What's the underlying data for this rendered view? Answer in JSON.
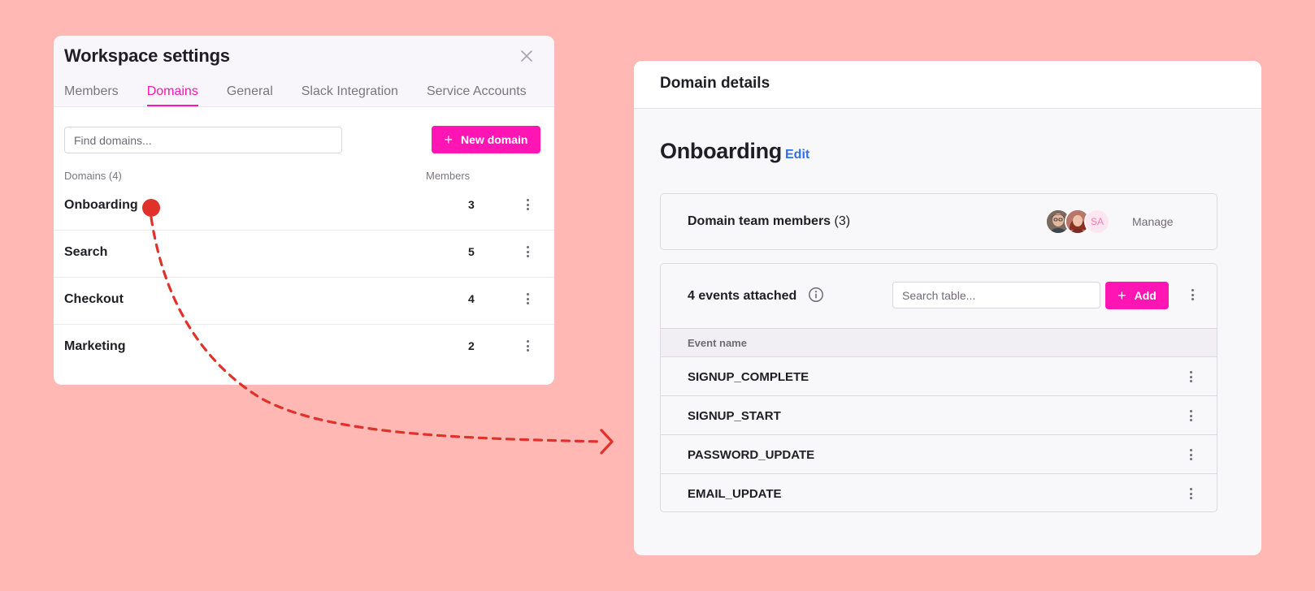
{
  "workspace_settings": {
    "title": "Workspace settings",
    "tabs": [
      {
        "label": "Members",
        "active": false
      },
      {
        "label": "Domains",
        "active": true
      },
      {
        "label": "General",
        "active": false
      },
      {
        "label": "Slack Integration",
        "active": false
      },
      {
        "label": "Service Accounts",
        "active": false
      }
    ],
    "search": {
      "placeholder": "Find domains...",
      "value": ""
    },
    "new_domain_label": "New domain",
    "columns": {
      "domains": "Domains (4)",
      "members": "Members"
    },
    "domains": [
      {
        "name": "Onboarding",
        "members": "3"
      },
      {
        "name": "Search",
        "members": "5"
      },
      {
        "name": "Checkout",
        "members": "4"
      },
      {
        "name": "Marketing",
        "members": "2"
      }
    ]
  },
  "domain_details": {
    "header_title": "Domain details",
    "domain_name": "Onboarding",
    "edit_label": "Edit",
    "team_members": {
      "label": "Domain team members",
      "count": "(3)",
      "avatar_initials": "SA",
      "manage_label": "Manage"
    },
    "events": {
      "title": "4 events attached",
      "search_placeholder": "Search table...",
      "add_label": "Add",
      "column_header": "Event name",
      "rows": [
        {
          "name": "SIGNUP_COMPLETE"
        },
        {
          "name": "SIGNUP_START"
        },
        {
          "name": "PASSWORD_UPDATE"
        },
        {
          "name": "EMAIL_UPDATE"
        }
      ]
    }
  },
  "colors": {
    "background": "#ffb8b3",
    "accent_pink": "#ff14b4",
    "link_blue": "#2d6ff0",
    "connector_red": "#e0322b"
  },
  "icons": {
    "close": "close-icon",
    "plus": "plus-icon",
    "more": "more-vertical-icon",
    "info": "info-icon",
    "connector_dot": "selection-dot-icon",
    "arrow": "chevron-right-arrow-icon"
  }
}
